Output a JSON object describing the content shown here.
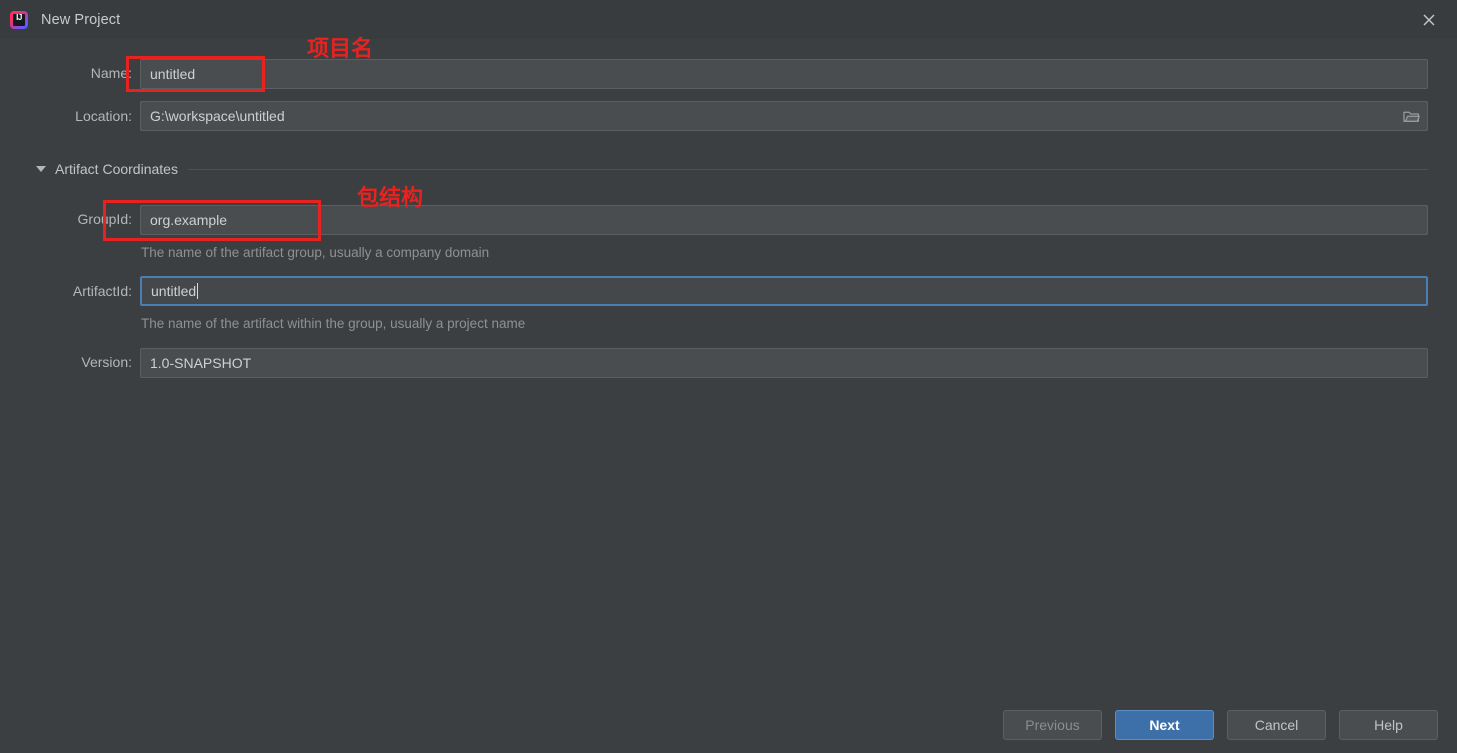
{
  "window": {
    "title": "New Project",
    "icon": "intellij-idea-logo",
    "close_icon": "close-icon"
  },
  "form": {
    "name": {
      "label": "Name:",
      "value": "untitled"
    },
    "location": {
      "label": "Location:",
      "value": "G:\\workspace\\untitled",
      "browse_icon": "folder-browse-icon"
    }
  },
  "section": {
    "title": "Artifact Coordinates",
    "collapse_icon": "triangle-down-icon",
    "expanded": true
  },
  "coordinates": {
    "group_id": {
      "label": "GroupId:",
      "value": "org.example",
      "hint": "The name of the artifact group, usually a company domain"
    },
    "artifact_id": {
      "label": "ArtifactId:",
      "value": "untitled",
      "hint": "The name of the artifact within the group, usually a project name",
      "focused": true
    },
    "version": {
      "label": "Version:",
      "value": "1.0-SNAPSHOT"
    }
  },
  "annotations": [
    {
      "text": "项目名",
      "target": "name-field"
    },
    {
      "text": "包结构",
      "target": "group-id-field"
    }
  ],
  "buttons": {
    "previous": "Previous",
    "next": "Next",
    "cancel": "Cancel",
    "help": "Help"
  },
  "colors": {
    "background": "#3c3f41",
    "titlebar": "#393c3e",
    "field": "#4a4d4f",
    "focus_border": "#4a7eb5",
    "primary_button": "#3d6fa8",
    "annotation": "#e8221f",
    "hint_text": "#8e9091"
  }
}
